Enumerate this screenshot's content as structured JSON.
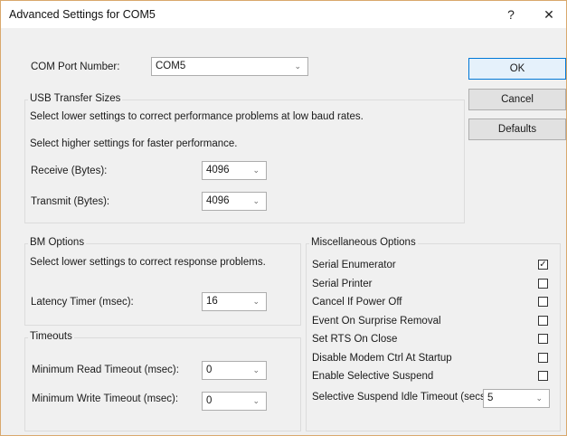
{
  "window": {
    "title": "Advanced Settings for COM5",
    "help_label": "?",
    "close_label": "✕"
  },
  "com_port": {
    "label": "COM Port Number:",
    "value": "COM5"
  },
  "buttons": {
    "ok": "OK",
    "cancel": "Cancel",
    "defaults": "Defaults"
  },
  "usb": {
    "title": "USB Transfer Sizes",
    "desc1": "Select lower settings to correct performance problems at low baud rates.",
    "desc2": "Select higher settings for faster performance.",
    "receive_label": "Receive (Bytes):",
    "receive_value": "4096",
    "transmit_label": "Transmit (Bytes):",
    "transmit_value": "4096"
  },
  "bm": {
    "title": "BM Options",
    "desc": "Select lower settings to correct response problems.",
    "latency_label": "Latency Timer (msec):",
    "latency_value": "16"
  },
  "timeouts": {
    "title": "Timeouts",
    "read_label": "Minimum Read Timeout (msec):",
    "read_value": "0",
    "write_label": "Minimum Write Timeout (msec):",
    "write_value": "0"
  },
  "misc": {
    "title": "Miscellaneous Options",
    "options": [
      {
        "label": "Serial Enumerator",
        "checked": true
      },
      {
        "label": "Serial Printer",
        "checked": false
      },
      {
        "label": "Cancel If Power Off",
        "checked": false
      },
      {
        "label": "Event On Surprise Removal",
        "checked": false
      },
      {
        "label": "Set RTS On Close",
        "checked": false
      },
      {
        "label": "Disable Modem Ctrl At Startup",
        "checked": false
      },
      {
        "label": "Enable Selective Suspend",
        "checked": false
      }
    ],
    "idle_label": "Selective Suspend Idle Timeout (secs):",
    "idle_value": "5"
  },
  "icons": {
    "chevron": "chevron-down-icon",
    "check": "checkmark-icon"
  }
}
